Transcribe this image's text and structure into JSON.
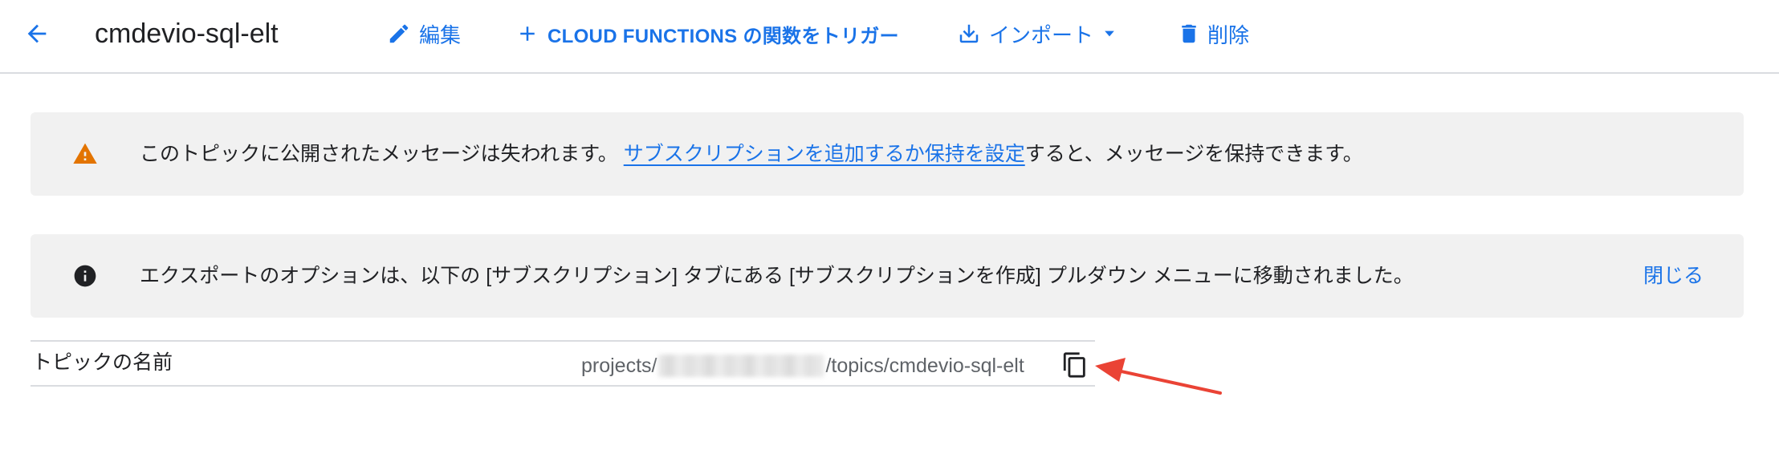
{
  "header": {
    "title": "cmdevio-sql-elt",
    "actions": {
      "edit": "編集",
      "trigger": "CLOUD FUNCTIONS の関数をトリガー",
      "import": "インポート",
      "delete": "削除"
    }
  },
  "warning_banner": {
    "text_before": "このトピックに公開されたメッセージは失われます。 ",
    "link": "サブスクリプションを追加するか保持を設定",
    "text_after": "すると、メッセージを保持できます。"
  },
  "info_banner": {
    "text": "エクスポートのオプションは、以下の [サブスクリプション] タブにある [サブスクリプションを作成] プルダウン メニューに移動されました。",
    "close": "閉じる"
  },
  "details": {
    "label": "トピックの名前",
    "value_prefix": "projects/",
    "value_suffix": "/topics/cmdevio-sql-elt"
  },
  "colors": {
    "accent": "#1a73e8",
    "warning": "#e37400",
    "arrow": "#ea4335"
  },
  "icons": [
    "arrow-back-icon",
    "pencil-icon",
    "plus-icon",
    "download-icon",
    "caret-down-icon",
    "trash-icon",
    "warning-icon",
    "info-icon",
    "copy-icon"
  ]
}
